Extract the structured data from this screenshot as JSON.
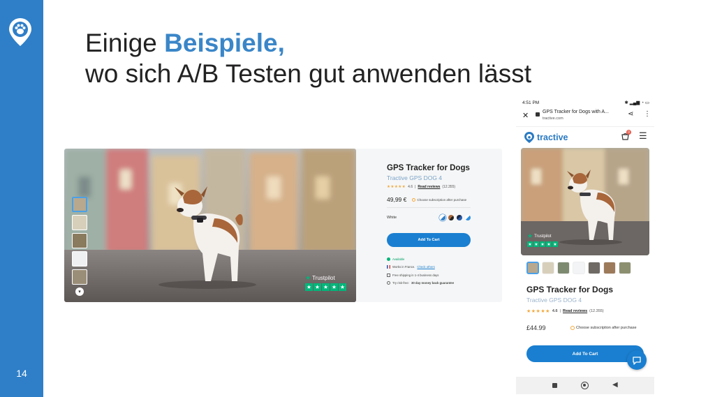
{
  "slide": {
    "title_line1_prefix": "Einige ",
    "title_line1_accent": "Beispiele,",
    "title_line2": "wo sich A/B Testen gut anwenden lässt",
    "page_number": "14",
    "accent_color": "#3a86c8",
    "sidebar_color": "#2f7fc8"
  },
  "desktop": {
    "product_title": "GPS Tracker for Dogs",
    "product_subtitle": "Tractive GPS DOG 4",
    "rating_value": "4.6",
    "read_reviews": "Read reviews",
    "review_count": "(12.355)",
    "price": "49,99 €",
    "subscription_note": "Choose subscription after purchase",
    "color_label": "White",
    "add_to_cart": "Add To Cart",
    "features": [
      "Available",
      "Works in France.",
      "Check others",
      "Free shipping in 1-4 business days",
      "Try risk-free:",
      "30 day money back guarantee"
    ],
    "trustpilot": "Trustpilot"
  },
  "phone": {
    "status_time": "4:51 PM",
    "page_title": "GPS Tracker for Dogs with A...",
    "host": "tractive.com",
    "brand": "tractive",
    "cart_badge": "0",
    "trustpilot": "Trustpilot",
    "product_title": "GPS Tracker for Dogs",
    "product_subtitle": "Tractive GPS DOG 4",
    "rating_value": "4.6",
    "read_reviews": "Read reviews",
    "review_count": "(12.355)",
    "price": "£44.99",
    "subscription_note": "Choose subscription after purchase",
    "add_to_cart": "Add To Cart"
  },
  "icons": [
    "paw-logo-icon",
    "close-icon",
    "lock-icon",
    "share-icon",
    "kebab-menu-icon",
    "cart-icon",
    "hamburger-menu-icon",
    "chat-icon",
    "chevron-down-icon",
    "trustpilot-star-icon"
  ],
  "colors": {
    "cta": "#1a7fd0",
    "trustpilot": "#00b67a",
    "stars": "#f3a83b",
    "brand": "#2a7ac2"
  }
}
